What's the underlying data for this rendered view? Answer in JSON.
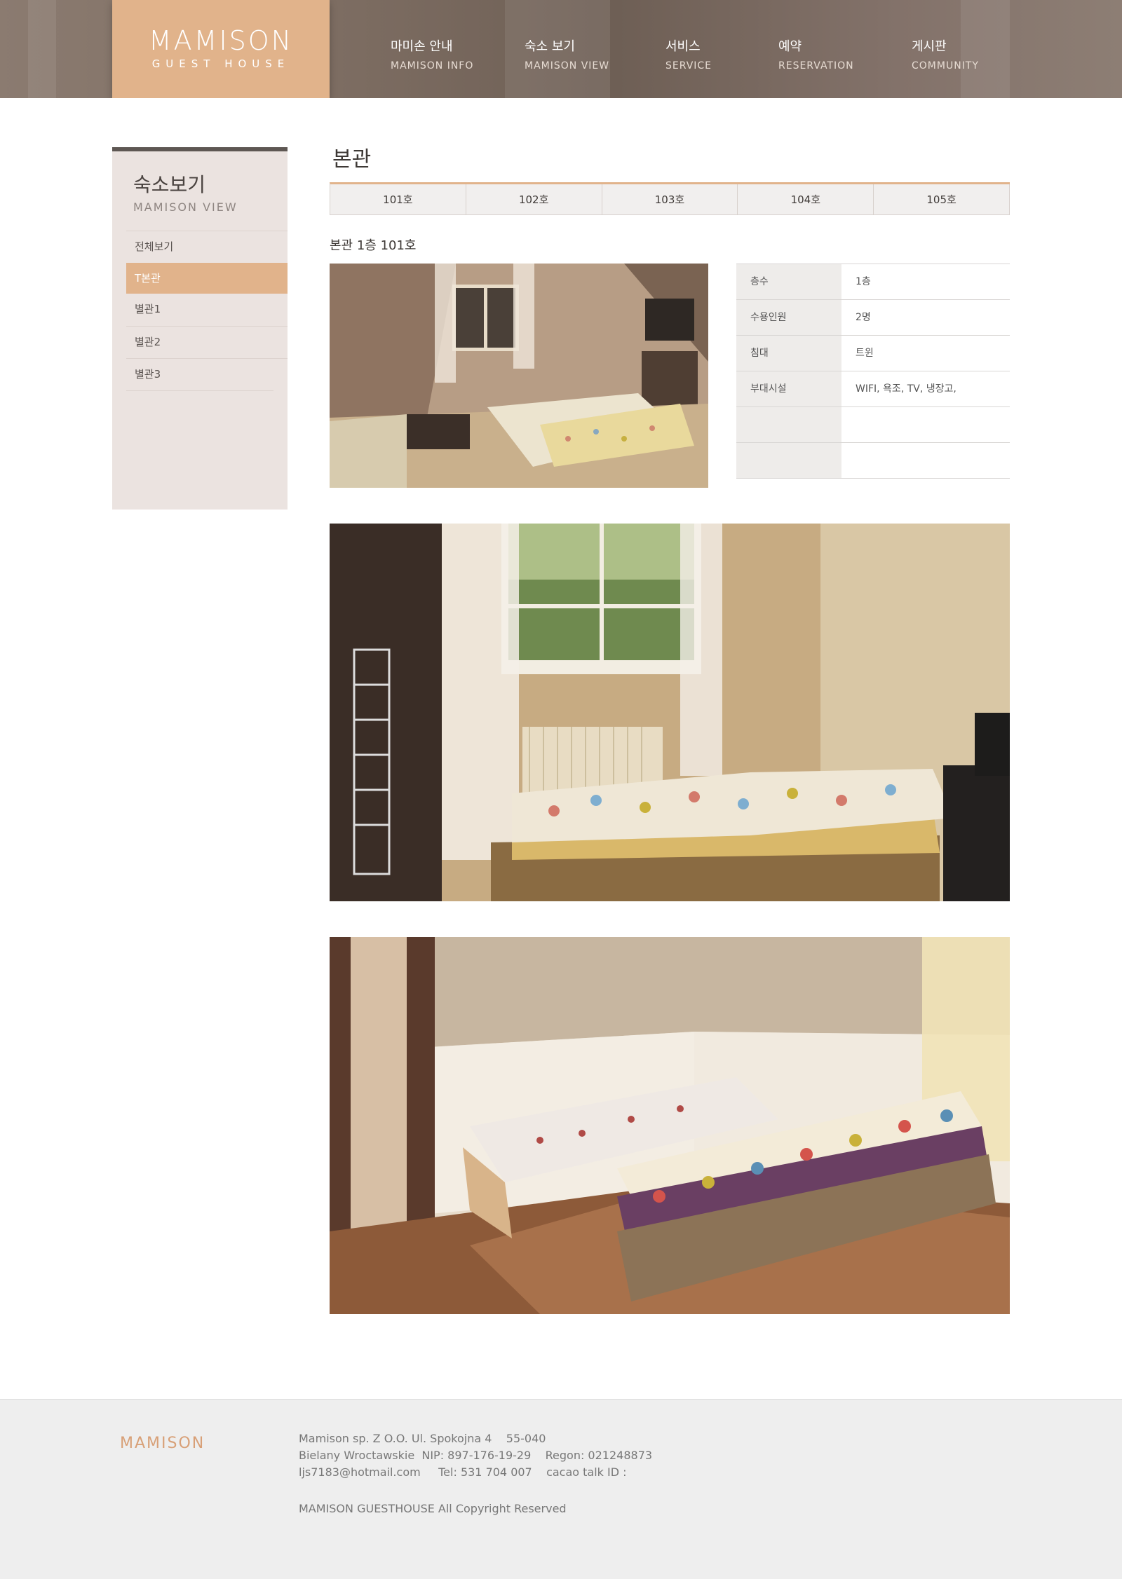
{
  "header": {
    "logo_main": "MAMISON",
    "logo_sub": "GUEST HOUSE",
    "nav": [
      {
        "ko": "마미손 안내",
        "en": "MAMISON INFO"
      },
      {
        "ko": "숙소 보기",
        "en": "MAMISON VIEW"
      },
      {
        "ko": "서비스",
        "en": "SERVICE"
      },
      {
        "ko": "예약",
        "en": "RESERVATION"
      },
      {
        "ko": "게시판",
        "en": "COMMUNITY"
      }
    ]
  },
  "sidebar": {
    "title": "숙소보기",
    "subtitle": "MAMISON VIEW",
    "items": [
      {
        "label": "전체보기"
      },
      {
        "label": "T본관"
      },
      {
        "label": "별관1"
      },
      {
        "label": "별관2"
      },
      {
        "label": "별관3"
      }
    ],
    "active_item": "T본관"
  },
  "main": {
    "page_title": "본관",
    "tabs": [
      "101호",
      "102호",
      "103호",
      "104호",
      "105호"
    ],
    "room_heading": "본관 1층 101호",
    "info": [
      {
        "key": "층수",
        "value": "1층"
      },
      {
        "key": "수용인원",
        "value": "2명"
      },
      {
        "key": "침대",
        "value": "트윈"
      },
      {
        "key": "부대시설",
        "value": "WIFI, 욕조, TV, 냉장고,"
      },
      {
        "key": "",
        "value": ""
      },
      {
        "key": "",
        "value": ""
      }
    ]
  },
  "footer": {
    "logo": "MAMISON",
    "line1": "Mamison sp. Z O.O. Ul. Spokojna 4    55-040",
    "line2": "Bielany Wroctawskie  NIP: 897-176-19-29    Regon: 021248873",
    "line3": "ljs7183@hotmail.com     Tel: 531 704 007    cacao talk ID :",
    "copyright": "MAMISON GUESTHOUSE All Copyright Reserved"
  },
  "colors": {
    "accent": "#e1b38b",
    "header_bg": "#7d6d62",
    "sidebar_bg": "#ebe3e0",
    "footer_bg": "#eeeeee"
  }
}
